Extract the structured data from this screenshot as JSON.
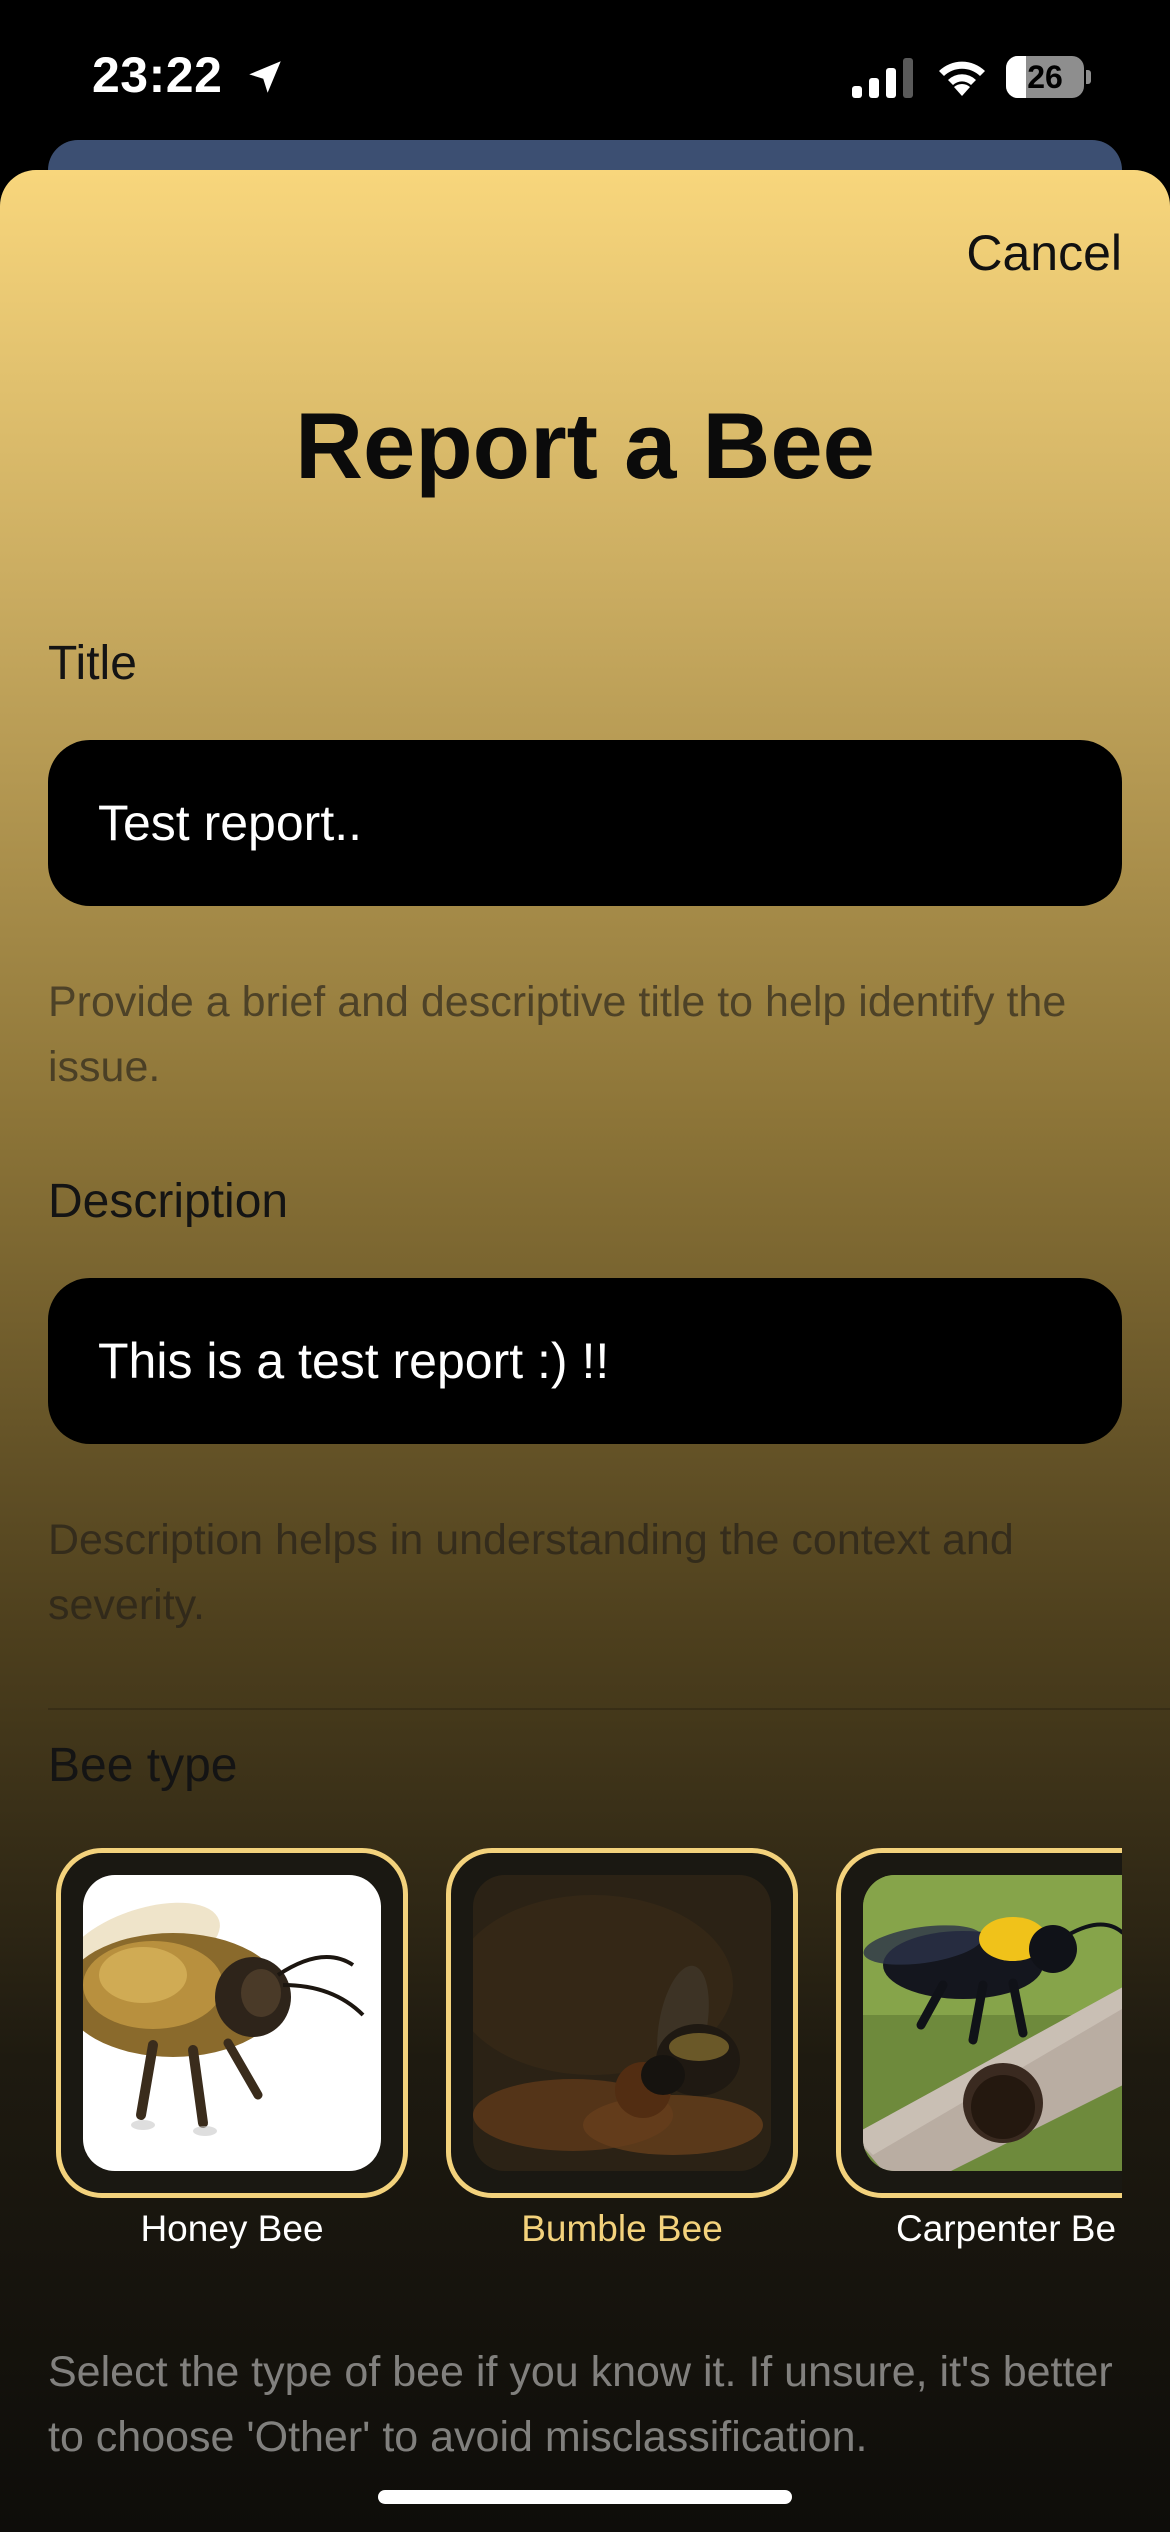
{
  "status_bar": {
    "time": "23:22",
    "battery_level": "26",
    "battery_fraction": 0.26
  },
  "sheet": {
    "cancel_label": "Cancel",
    "title": "Report a Bee"
  },
  "form": {
    "title_label": "Title",
    "title_value": "Test report..",
    "title_helper": "Provide a brief and descriptive title to help identify the issue.",
    "description_label": "Description",
    "description_value": "This is a test report :) !!",
    "description_helper": "Description helps in understanding the context and severity.",
    "bee_type_label": "Bee type",
    "bee_types": [
      {
        "name": "Honey Bee",
        "selected": false
      },
      {
        "name": "Bumble Bee",
        "selected": true
      },
      {
        "name": "Carpenter Be",
        "selected": false
      }
    ],
    "bee_type_helper": "Select the type of bee if you know it. If unsure, it's better to choose 'Other' to avoid misclassification."
  },
  "colors": {
    "accent": "#f3d27c",
    "sheet_top": "#f8d67c",
    "sheet_bottom": "#0e0d0a",
    "field_background": "#000000"
  }
}
